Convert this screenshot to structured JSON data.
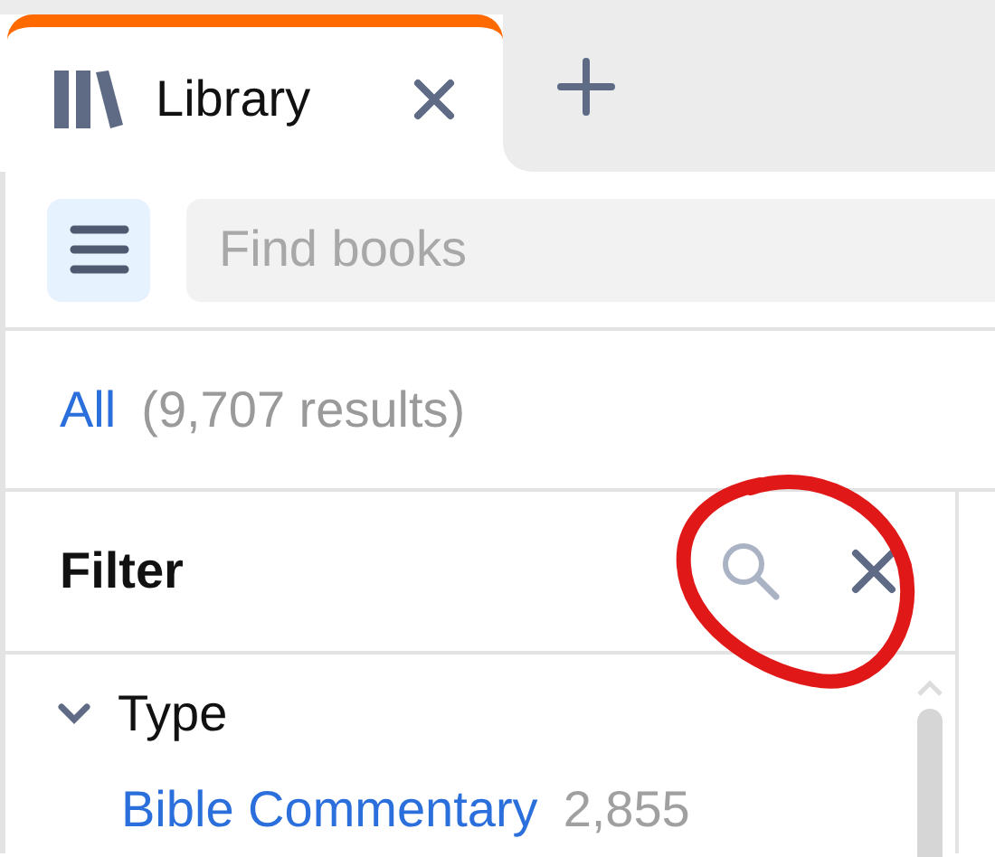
{
  "tabs": [
    {
      "label": "Library",
      "selected": true
    }
  ],
  "search": {
    "placeholder": "Find books"
  },
  "results": {
    "scope": "All",
    "count": "(9,707 results)"
  },
  "filter": {
    "title": "Filter",
    "groups": [
      {
        "label": "Type",
        "expanded": true,
        "items": [
          {
            "label": "Bible Commentary",
            "count": "2,855"
          }
        ]
      }
    ]
  }
}
